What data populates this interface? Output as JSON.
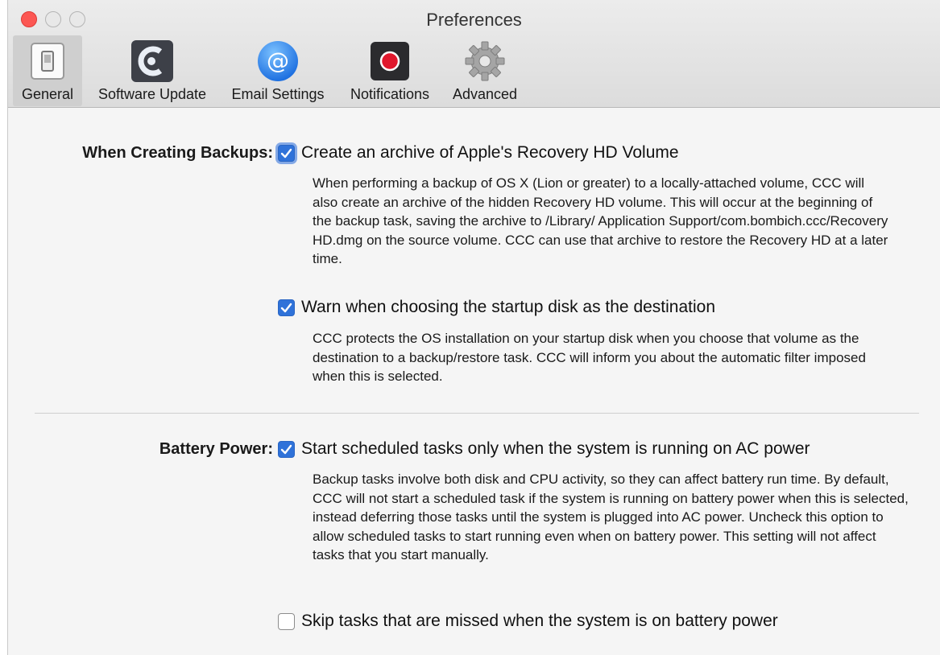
{
  "window": {
    "title": "Preferences"
  },
  "toolbar": {
    "items": [
      {
        "label": "General",
        "icon": "switch-icon",
        "selected": true
      },
      {
        "label": "Software Update",
        "icon": "ccc-logo-icon",
        "selected": false
      },
      {
        "label": "Email Settings",
        "icon": "at-sign-icon",
        "selected": false
      },
      {
        "label": "Notifications",
        "icon": "record-icon",
        "selected": false
      },
      {
        "label": "Advanced",
        "icon": "gear-icon",
        "selected": false
      }
    ]
  },
  "backups": {
    "section_label": "When Creating Backups:",
    "options": [
      {
        "label": "Create an archive of Apple's Recovery HD Volume",
        "checked": true,
        "description": "When performing a backup of OS X (Lion or greater) to a locally-attached volume, CCC will also create an archive of the hidden Recovery HD volume. This will occur at the beginning of the backup task, saving the archive to /Library/ Application Support/com.bombich.ccc/Recovery HD.dmg on the source volume. CCC can use that archive to restore the Recovery HD at a later time."
      },
      {
        "label": "Warn when choosing the startup disk as the destination",
        "checked": true,
        "description": "CCC protects the OS installation on your startup disk when you choose that volume as the destination to a backup/restore task. CCC will inform you about the automatic filter imposed when this is selected."
      }
    ]
  },
  "battery": {
    "section_label": "Battery Power:",
    "options": [
      {
        "label": "Start scheduled tasks only when the system is running on AC power",
        "checked": true,
        "description": "Backup tasks involve both disk and CPU activity, so they can affect battery run time. By default, CCC will not start a scheduled task if the system is running on battery power when this is selected, instead deferring those tasks until the system is plugged into AC power. Uncheck this option to allow scheduled tasks to start running even when on battery power. This setting will not affect tasks that you start manually."
      },
      {
        "label": "Skip tasks that are missed when the system is on battery power",
        "checked": false
      }
    ]
  },
  "colors": {
    "accent": "#2f72d9",
    "close": "#fc5753",
    "record": "#e0182d"
  }
}
